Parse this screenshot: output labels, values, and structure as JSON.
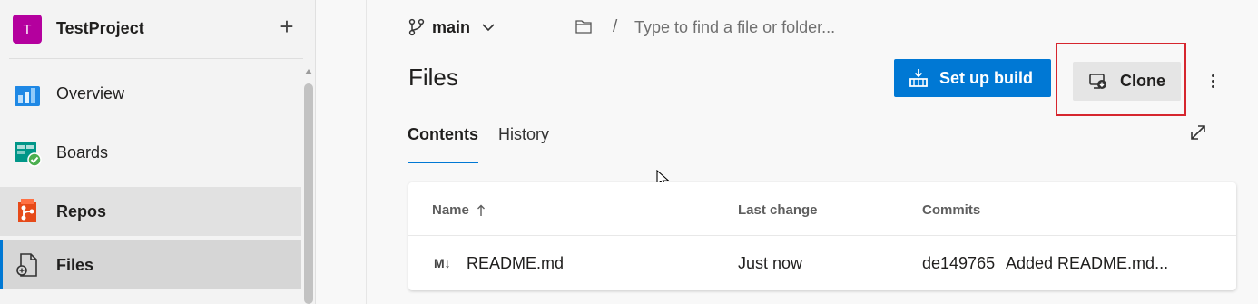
{
  "project": {
    "avatar_letter": "T",
    "name": "TestProject",
    "add_label": "+"
  },
  "sidebar": {
    "items": [
      {
        "label": "Overview",
        "icon": "overview-icon"
      },
      {
        "label": "Boards",
        "icon": "boards-icon"
      },
      {
        "label": "Repos",
        "icon": "repos-icon"
      },
      {
        "label": "Files",
        "icon": "files-icon"
      }
    ]
  },
  "header": {
    "branch": "main",
    "path_separator": "/",
    "path_placeholder": "Type to find a file or folder..."
  },
  "page": {
    "title": "Files",
    "setup_build_label": "Set up build",
    "clone_label": "Clone"
  },
  "tabs": [
    {
      "label": "Contents",
      "selected": true
    },
    {
      "label": "History",
      "selected": false
    }
  ],
  "table": {
    "columns": [
      "Name",
      "Last change",
      "Commits"
    ],
    "sort_indicator": "↑",
    "rows": [
      {
        "icon": "M↓",
        "name": "README.md",
        "last_change": "Just now",
        "commit_hash": "de149765",
        "commit_message": "Added README.md..."
      }
    ]
  },
  "colors": {
    "accent": "#0078d4",
    "highlight_box": "#d6262e",
    "avatar": "#b4009e"
  }
}
